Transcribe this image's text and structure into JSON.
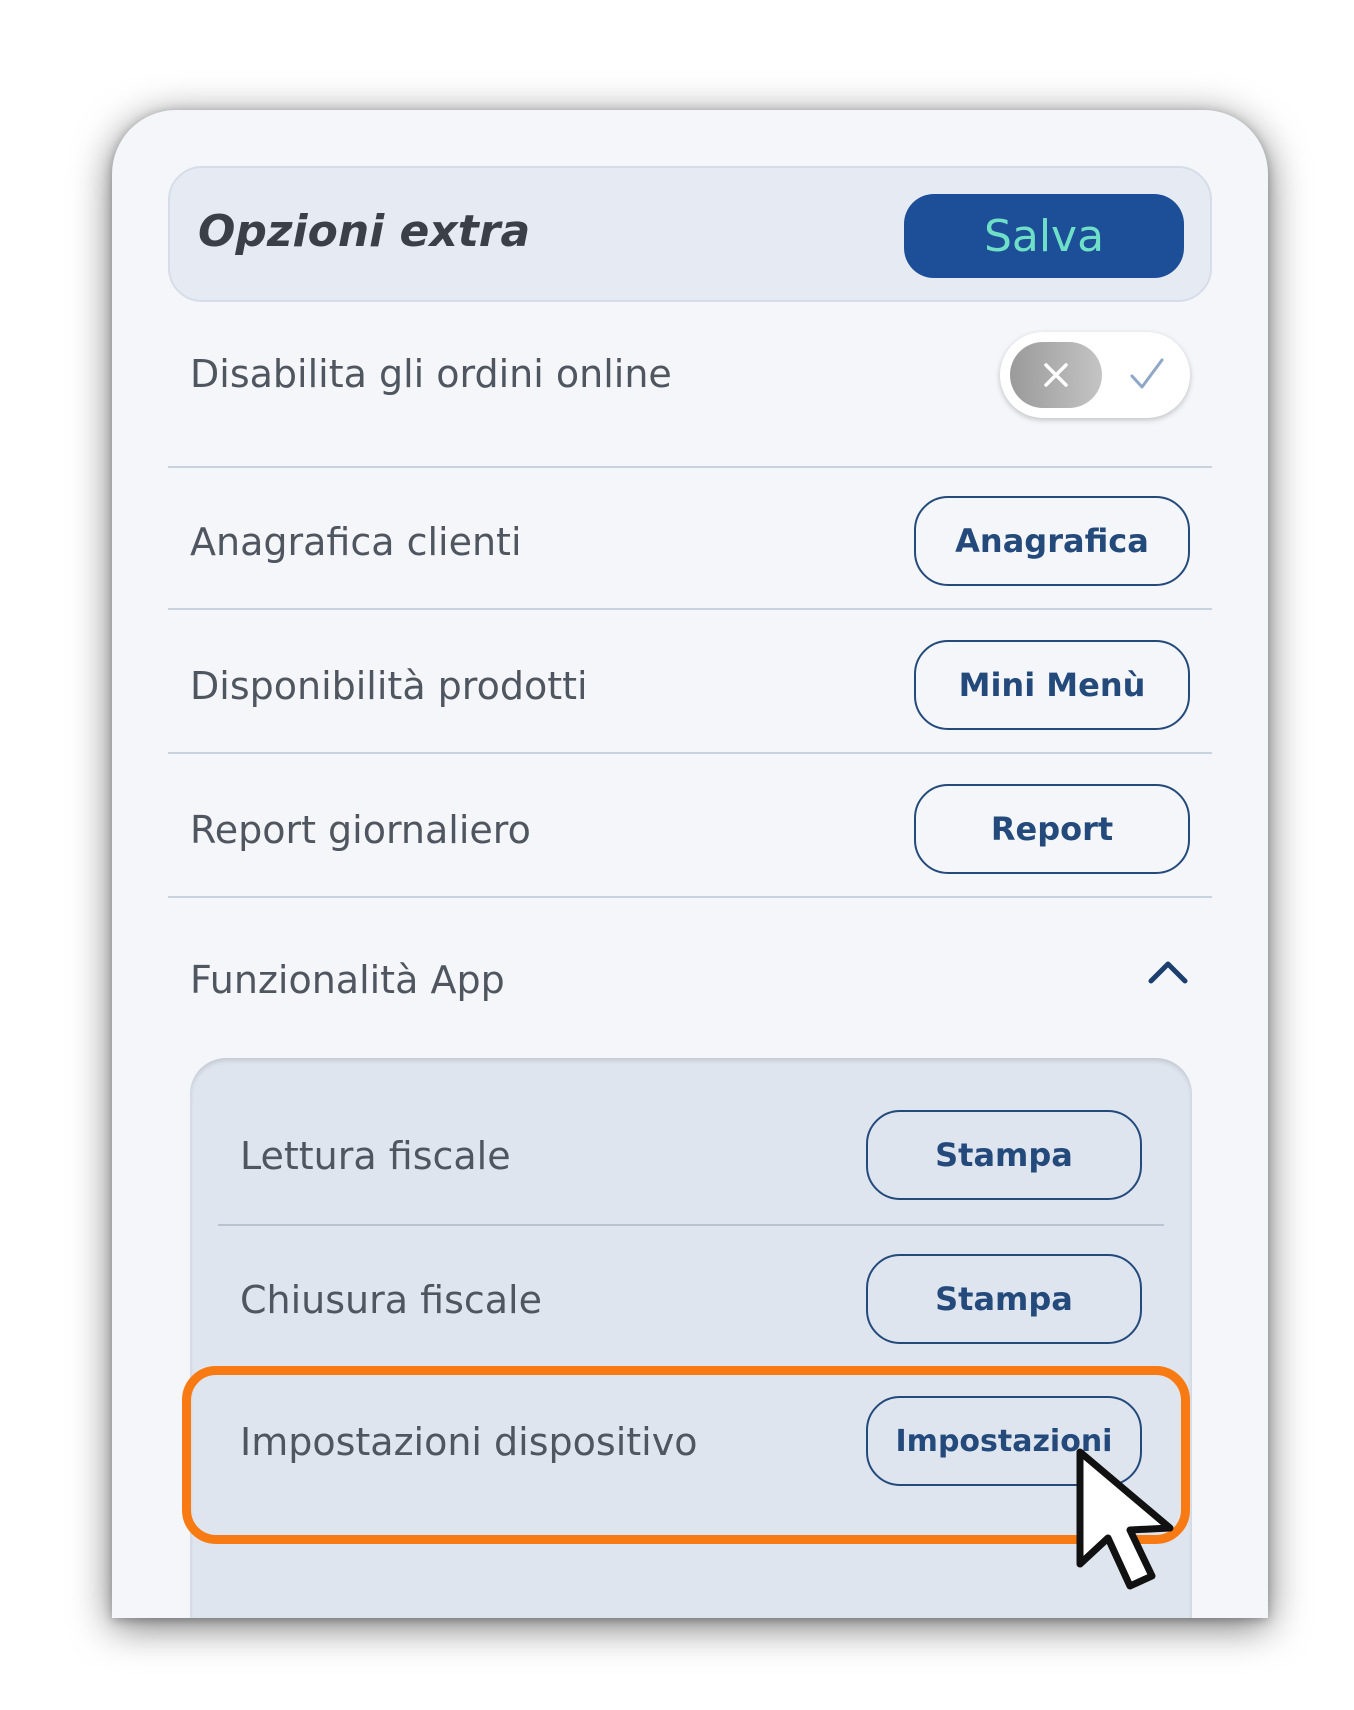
{
  "header": {
    "title": "Opzioni extra",
    "save_label": "Salva"
  },
  "rows": [
    {
      "label": "Disabilita gli ordini online",
      "control": "toggle",
      "toggle_state": "off"
    },
    {
      "label": "Anagrafica clienti",
      "button": "Anagrafica"
    },
    {
      "label": "Disponibilità prodotti",
      "button": "Mini Menù"
    },
    {
      "label": "Report giornaliero",
      "button": "Report"
    }
  ],
  "section": {
    "label": "Funzionalità App",
    "expanded": true,
    "items": [
      {
        "label": "Lettura fiscale",
        "button": "Stampa"
      },
      {
        "label": "Chiusura fiscale",
        "button": "Stampa"
      },
      {
        "label": "Impostazioni dispositivo",
        "button": "Impostazioni"
      }
    ]
  },
  "colors": {
    "accent": "#1c4f98",
    "save_text": "#6fe0c7",
    "outline": "#244a7c",
    "highlight": "#f77b12"
  },
  "icons": [
    "x-icon",
    "check-icon",
    "chevron-up-icon",
    "mouse-cursor-icon"
  ]
}
